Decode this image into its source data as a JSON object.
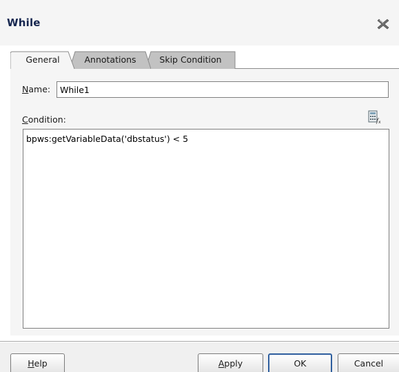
{
  "dialog": {
    "title": "While",
    "close_icon": "close-x-icon"
  },
  "tabs": [
    {
      "label": "General",
      "selected": true
    },
    {
      "label": "Annotations",
      "selected": false
    },
    {
      "label": "Skip Condition",
      "selected": false
    }
  ],
  "general": {
    "name_label_mnemonic": "N",
    "name_label_rest": "ame:",
    "name_value": "While1",
    "condition_label_mnemonic": "C",
    "condition_label_rest": "ondition:",
    "condition_value": "bpws:getVariableData('dbstatus') < 5",
    "expression_builder_icon": "expression-builder-icon"
  },
  "buttons": {
    "help_mnemonic": "H",
    "help_rest": "elp",
    "apply_mnemonic": "A",
    "apply_rest": "pply",
    "ok": "OK",
    "cancel": "Cancel"
  },
  "colors": {
    "title": "#16264f",
    "selected_tab": "#f5f5f5",
    "unselected_tab": "#c2c2c2",
    "default_button_border": "#2e5e9e"
  }
}
